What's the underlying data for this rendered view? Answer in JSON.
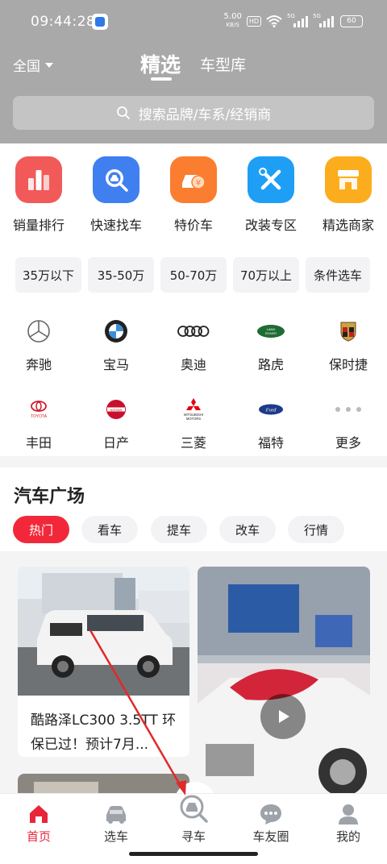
{
  "status_bar": {
    "time": "09:44:28",
    "net_speed": "5.00",
    "net_unit": "KB/S",
    "hd": "HD",
    "sig1": "5G",
    "sig2": "5G",
    "battery": "60"
  },
  "header": {
    "region": "全国",
    "tab_active": "精选",
    "tab_other": "车型库"
  },
  "search": {
    "placeholder": "搜索品牌/车系/经销商"
  },
  "categories": [
    {
      "label": "销量排行",
      "icon": "bar-chart-icon",
      "color": "#f25a5a"
    },
    {
      "label": "快速找车",
      "icon": "car-search-icon",
      "color": "#3f7ff0"
    },
    {
      "label": "特价车",
      "icon": "price-tag-car-icon",
      "color": "#fb7d2f"
    },
    {
      "label": "改装专区",
      "icon": "tools-icon",
      "color": "#1e9ff5"
    },
    {
      "label": "精选商家",
      "icon": "storefront-icon",
      "color": "#fcad1d"
    }
  ],
  "price_filters": [
    "35万以下",
    "35-50万",
    "50-70万",
    "70万以上",
    "条件选车"
  ],
  "brands": [
    {
      "label": "奔驰",
      "icon": "mercedes-logo-icon"
    },
    {
      "label": "宝马",
      "icon": "bmw-logo-icon"
    },
    {
      "label": "奥迪",
      "icon": "audi-logo-icon"
    },
    {
      "label": "路虎",
      "icon": "land-rover-logo-icon",
      "logo_text": "LAND ROVER"
    },
    {
      "label": "保时捷",
      "icon": "porsche-logo-icon"
    },
    {
      "label": "丰田",
      "icon": "toyota-logo-icon",
      "logo_text": "TOYOTA"
    },
    {
      "label": "日产",
      "icon": "nissan-logo-icon",
      "logo_text": "NISSAN"
    },
    {
      "label": "三菱",
      "icon": "mitsubishi-logo-icon",
      "logo_text": "MITSUBISHI MOTORS"
    },
    {
      "label": "福特",
      "icon": "ford-logo-icon",
      "logo_text": "Ford"
    },
    {
      "label": "更多",
      "icon": "more-dots-icon"
    }
  ],
  "plaza": {
    "title": "汽车广场",
    "filters": [
      "热门",
      "看车",
      "提车",
      "改车",
      "行情"
    ],
    "active_filter": "热门"
  },
  "posts": [
    {
      "title": "酷路泽LC300 3.5TT 环保已过！预计7月..."
    }
  ],
  "tabbar": [
    {
      "label": "首页",
      "icon": "home-icon",
      "active": true
    },
    {
      "label": "选车",
      "icon": "car-icon",
      "active": false
    },
    {
      "label": "寻车",
      "icon": "find-car-icon",
      "active": false
    },
    {
      "label": "车友圈",
      "icon": "chat-bubble-icon",
      "active": false
    },
    {
      "label": "我的",
      "icon": "profile-icon",
      "active": false
    }
  ],
  "colors": {
    "accent": "#f2283a",
    "header_bg": "#a9a9a9"
  }
}
